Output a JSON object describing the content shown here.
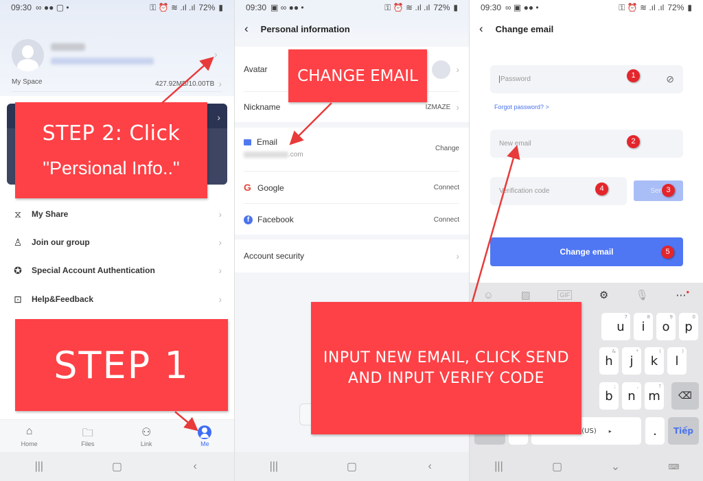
{
  "status_bar": {
    "time": "09:30",
    "battery": "72%"
  },
  "screen1": {
    "my_space_label": "My Space",
    "my_space_value": "427.92MB/10.00TB",
    "menu": [
      {
        "icon": "share-icon",
        "label": "My Share"
      },
      {
        "icon": "join-group-icon",
        "label": "Join our group"
      },
      {
        "icon": "verified-badge-icon",
        "label": "Special Account Authentication"
      },
      {
        "icon": "feedback-icon",
        "label": "Help&Feedback"
      }
    ],
    "tabs": [
      {
        "icon": "home-icon",
        "label": "Home",
        "active": false
      },
      {
        "icon": "folder-icon",
        "label": "Files",
        "active": false
      },
      {
        "icon": "link-icon",
        "label": "Link",
        "active": false
      },
      {
        "icon": "user-icon",
        "label": "Me",
        "active": true
      }
    ],
    "callout_step2_line1": "STEP 2: Click",
    "callout_step2_line2": "\"Persional Info..\"",
    "callout_step1": "STEP 1"
  },
  "screen2": {
    "title": "Personal information",
    "rows": {
      "avatar": "Avatar",
      "nickname": "Nickname",
      "nickname_value": "IZMAZE",
      "email": "Email",
      "email_value_suffix": ".com",
      "email_action": "Change",
      "google": "Google",
      "google_action": "Connect",
      "facebook": "Facebook",
      "facebook_action": "Connect",
      "account_security": "Account security"
    },
    "callout_change_email": "CHANGE EMAIL"
  },
  "screen3": {
    "title": "Change email",
    "password_placeholder": "Password",
    "forgot_password": "Forgot password? >",
    "new_email_placeholder": "New email",
    "verification_placeholder": "Verification code",
    "send_label": "Send",
    "submit_label": "Change email",
    "badges": [
      "1",
      "2",
      "3",
      "4",
      "5"
    ],
    "keyboard": {
      "row1": [
        {
          "k": "u",
          "n": "7"
        },
        {
          "k": "i",
          "n": "8"
        },
        {
          "k": "o",
          "n": "9"
        },
        {
          "k": "p",
          "n": "0"
        }
      ],
      "row2": [
        {
          "k": "h",
          "n": "&"
        },
        {
          "k": "j",
          "n": "*"
        },
        {
          "k": "k",
          "n": "("
        },
        {
          "k": "l",
          "n": ")"
        }
      ],
      "row3": [
        {
          "k": "b",
          "n": ";"
        },
        {
          "k": "n",
          "n": ","
        },
        {
          "k": "m",
          "n": "?"
        }
      ],
      "space_label": "(US)",
      "period": ".",
      "enter_label": "Tiếp"
    },
    "callout_input": [
      "INPUT NEW EMAIL, CLICK SEND",
      "AND INPUT VERIFY CODE"
    ]
  }
}
